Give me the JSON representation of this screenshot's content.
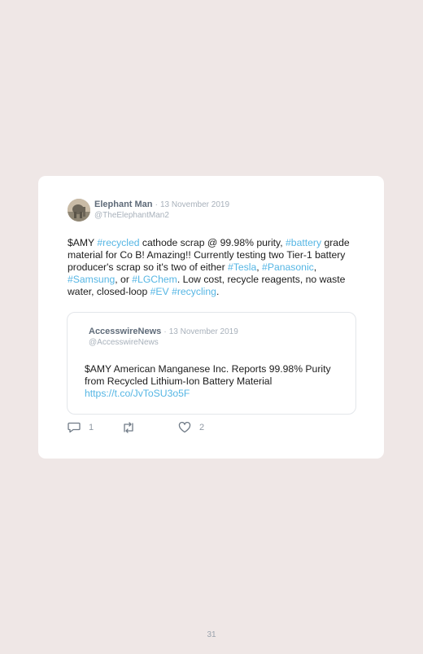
{
  "tweet": {
    "author_name": "Elephant Man",
    "separator": "·",
    "date": "13 November 2019",
    "handle": "@TheElephantMan2",
    "text_parts": [
      {
        "text": "$AMY ",
        "tag": false
      },
      {
        "text": "#recycled",
        "tag": true
      },
      {
        "text": " cathode scrap @ 99.98% purity, ",
        "tag": false
      },
      {
        "text": "#battery",
        "tag": true
      },
      {
        "text": " grade material for Co B! Amazing!! Currently testing two Tier-1 battery producer's scrap so it's two of either ",
        "tag": false
      },
      {
        "text": "#Tesla",
        "tag": true
      },
      {
        "text": ", ",
        "tag": false
      },
      {
        "text": "#Panasonic",
        "tag": true
      },
      {
        "text": ", ",
        "tag": false
      },
      {
        "text": "#Samsung",
        "tag": true
      },
      {
        "text": ", or ",
        "tag": false
      },
      {
        "text": "#LGChem",
        "tag": true
      },
      {
        "text": ". Low cost, recycle reagents, no waste water, closed-loop ",
        "tag": false
      },
      {
        "text": "#EV",
        "tag": true
      },
      {
        "text": " ",
        "tag": false
      },
      {
        "text": "#recycling",
        "tag": true
      },
      {
        "text": ".",
        "tag": false
      }
    ]
  },
  "quoted": {
    "author_name": "AccesswireNews",
    "separator": "·",
    "date": "13 November 2019",
    "handle": "@AccesswireNews",
    "text": "$AMY American Manganese Inc. Reports 99.98% Purity from Recycled Lithium-Ion Battery Material",
    "link": "https://t.co/JvToSU3o5F"
  },
  "actions": {
    "reply_count": "1",
    "retweet_count": "",
    "like_count": "2"
  },
  "page_number": "31",
  "colors": {
    "background": "#efe7e6",
    "card": "#ffffff",
    "hashtag": "#56b6e4",
    "meta": "#a8b1bb"
  },
  "icons": [
    "avatar",
    "reply-icon",
    "retweet-icon",
    "like-icon"
  ]
}
